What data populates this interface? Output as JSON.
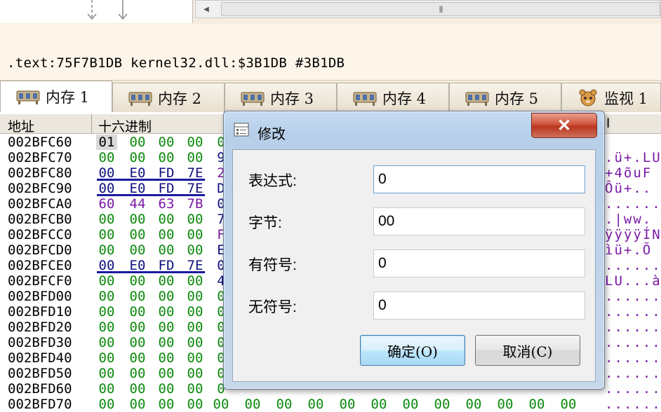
{
  "address_bar": {
    "text": ".text:75F7B1DB kernel32.dll:$3B1DB #3B1DB"
  },
  "tabs": [
    {
      "label": "内存 1",
      "icon": "memory-icon"
    },
    {
      "label": "内存 2",
      "icon": "memory-icon"
    },
    {
      "label": "内存 3",
      "icon": "memory-icon"
    },
    {
      "label": "内存 4",
      "icon": "memory-icon"
    },
    {
      "label": "内存 5",
      "icon": "memory-icon"
    },
    {
      "label": "监视 1",
      "icon": "watch-icon"
    }
  ],
  "hex_view": {
    "col_address": "地址",
    "col_hex": "十六进制",
    "col_ascii": "I",
    "rows": [
      {
        "addr": "002BFC60",
        "bytes": [
          "01",
          "00",
          "00",
          "00",
          "0"
        ],
        "ascii": ""
      },
      {
        "addr": "002BFC70",
        "bytes": [
          "00",
          "00",
          "00",
          "00",
          "9"
        ],
        "ascii": ".ü+.LU"
      },
      {
        "addr": "002BFC80",
        "bytes": [
          "00",
          "E0",
          "FD",
          "7E",
          "2"
        ],
        "ascii": "+4õuF"
      },
      {
        "addr": "002BFC90",
        "bytes": [
          "00",
          "E0",
          "FD",
          "7E",
          "D"
        ],
        "ascii": "Ôü+.."
      },
      {
        "addr": "002BFCA0",
        "bytes": [
          "60",
          "44",
          "63",
          "7B",
          "0"
        ],
        "ascii": "......"
      },
      {
        "addr": "002BFCB0",
        "bytes": [
          "00",
          "00",
          "00",
          "00",
          "7"
        ],
        "ascii": ".|ww."
      },
      {
        "addr": "002BFCC0",
        "bytes": [
          "00",
          "00",
          "00",
          "00",
          "F"
        ],
        "ascii": "ÿÿÿÿÍN"
      },
      {
        "addr": "002BFCD0",
        "bytes": [
          "00",
          "00",
          "00",
          "00",
          "E"
        ],
        "ascii": "ìü+.Õ"
      },
      {
        "addr": "002BFCE0",
        "bytes": [
          "00",
          "E0",
          "FD",
          "7E",
          "0"
        ],
        "ascii": "......"
      },
      {
        "addr": "002BFCF0",
        "bytes": [
          "00",
          "00",
          "00",
          "00",
          "4"
        ],
        "ascii": "LU...à"
      },
      {
        "addr": "002BFD00",
        "bytes": [
          "00",
          "00",
          "00",
          "00",
          "0"
        ],
        "ascii": "......"
      },
      {
        "addr": "002BFD10",
        "bytes": [
          "00",
          "00",
          "00",
          "00",
          "0"
        ],
        "ascii": "......"
      },
      {
        "addr": "002BFD20",
        "bytes": [
          "00",
          "00",
          "00",
          "00",
          "0"
        ],
        "ascii": "......"
      },
      {
        "addr": "002BFD30",
        "bytes": [
          "00",
          "00",
          "00",
          "00",
          "0"
        ],
        "ascii": "......"
      },
      {
        "addr": "002BFD40",
        "bytes": [
          "00",
          "00",
          "00",
          "00",
          "0"
        ],
        "ascii": "......"
      },
      {
        "addr": "002BFD50",
        "bytes": [
          "00",
          "00",
          "00",
          "00",
          "0"
        ],
        "ascii": "......"
      },
      {
        "addr": "002BFD60",
        "bytes": [
          "00",
          "00",
          "00",
          "00",
          "0"
        ],
        "ascii": "......"
      },
      {
        "addr": "002BFD70",
        "bytes": [
          "00",
          "00",
          "00",
          "00",
          "00",
          "00",
          "00",
          "00",
          "00",
          "00",
          "00",
          "00",
          "00",
          "00",
          "00",
          "00"
        ],
        "ascii": "......"
      }
    ]
  },
  "dialog": {
    "title": "修改",
    "close_label": "✕",
    "fields": [
      {
        "label": "表达式:",
        "value": "0"
      },
      {
        "label": "字节:",
        "value": "00"
      },
      {
        "label": "有符号:",
        "value": "0"
      },
      {
        "label": "无符号:",
        "value": "0"
      }
    ],
    "ok_label": "确定(O)",
    "cancel_label": "取消(C)"
  },
  "colors": {
    "hex_default": "#0b8a0b",
    "hex_pointer": "#7a1aa6",
    "hex_underline": "#1a1aa0"
  }
}
